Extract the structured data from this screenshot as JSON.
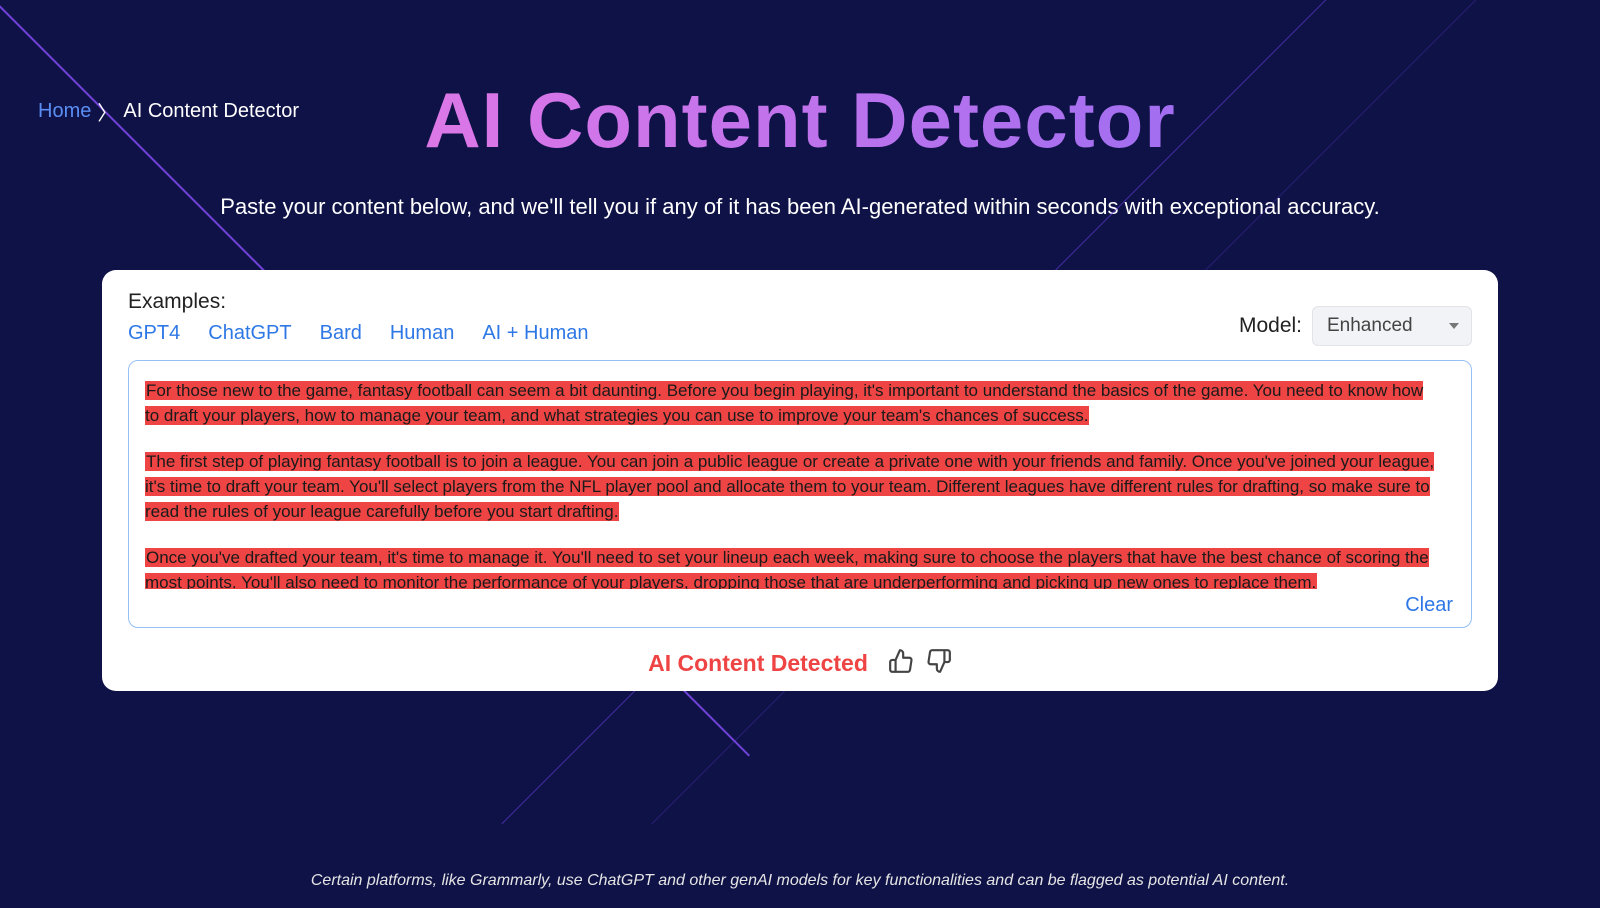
{
  "breadcrumb": {
    "home": "Home",
    "separator": "〉",
    "current": "AI Content Detector"
  },
  "hero": {
    "title": "AI Content Detector",
    "subtitle": "Paste your content below, and we'll tell you if any of it has been AI-generated within seconds with exceptional accuracy."
  },
  "examples": {
    "label": "Examples:",
    "links": [
      "GPT4",
      "ChatGPT",
      "Bard",
      "Human",
      "AI + Human"
    ]
  },
  "model": {
    "label": "Model:",
    "selected": "Enhanced"
  },
  "content": {
    "p1": "For those new to the game, fantasy football can seem a bit daunting. Before you begin playing, it's important to understand the basics of the game. You need to know how to draft your players, how to manage your team, and what strategies you can use to improve your team's chances of success.",
    "p2": "The first step of playing fantasy football is to join a league. You can join a public league or create a private one with your friends and family. Once you've joined your league, it's time to draft your team. You'll select players from the NFL player pool and allocate them to your team. Different leagues have different rules for drafting, so make sure to read the rules of your league carefully before you start drafting.",
    "p3": "Once you've drafted your team, it's time to manage it. You'll need to set your lineup each week, making sure to choose the players that have the best chance of scoring the most points. You'll also need to monitor the performance of your players, dropping those that are underperforming and picking up new ones to replace them."
  },
  "clear_label": "Clear",
  "result": "AI Content Detected",
  "disclaimer": "Certain platforms, like Grammarly, use ChatGPT and other genAI models for key functionalities and can be flagged as potential AI content."
}
